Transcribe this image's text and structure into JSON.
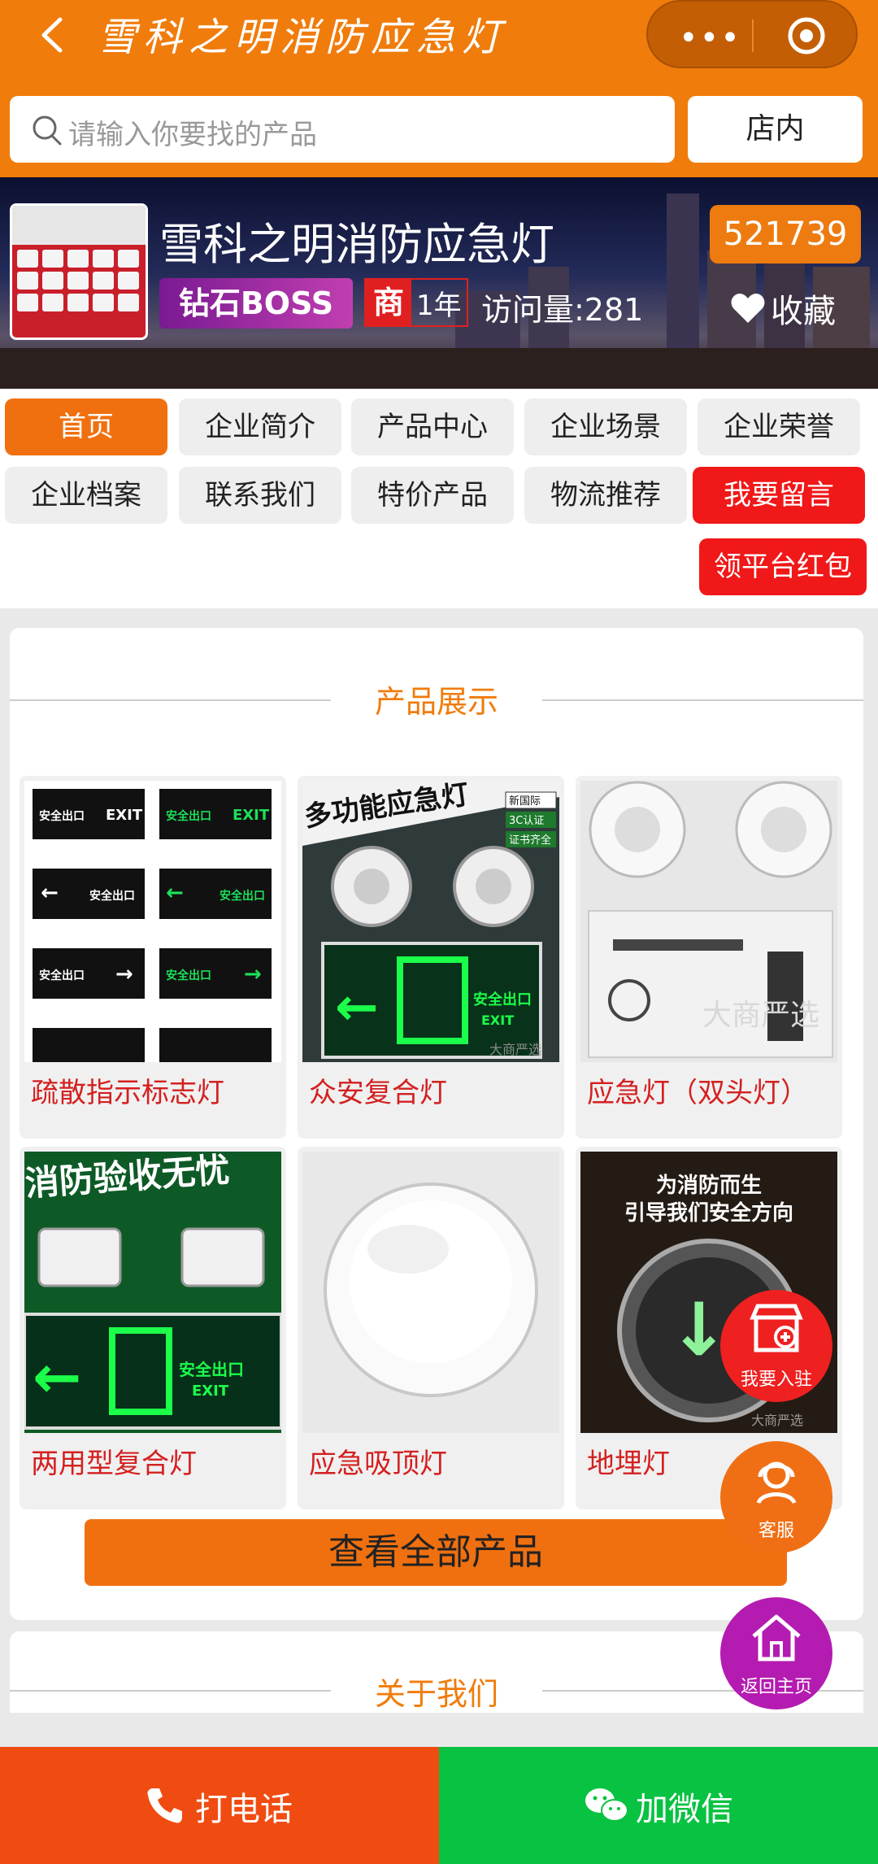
{
  "header": {
    "title": "雪科之明消防应急灯",
    "search_placeholder": "请输入你要找的产品",
    "store_search_label": "店内"
  },
  "shop": {
    "name": "雪科之明消防应急灯",
    "id_badge": "521739",
    "level_badge": "钻石BOSS",
    "merchant_mark": "商",
    "years": "1年",
    "visits": "访问量:281",
    "favorite_label": "收藏"
  },
  "nav": {
    "items": [
      "首页",
      "企业简介",
      "产品中心",
      "企业场景",
      "企业荣誉",
      "企业档案",
      "联系我们",
      "特价产品",
      "物流推荐",
      "我要留言"
    ],
    "red_packet": "领平台红包"
  },
  "products": {
    "section_title": "产品展示",
    "items": [
      {
        "name": "疏散指示标志灯"
      },
      {
        "name": "众安复合灯"
      },
      {
        "name": "应急灯（双头灯）"
      },
      {
        "name": "两用型复合灯"
      },
      {
        "name": "应急吸顶灯"
      },
      {
        "name": "地埋灯"
      }
    ],
    "image_texts": {
      "p2_headline": "多功能应急灯",
      "p2_tag1": "新国际",
      "p2_tag2": "3C认证",
      "p2_tag3": "证书齐全",
      "p4_headline": "消防验收无忧",
      "p6_line1": "为消防而生",
      "p6_line2": "引导我们安全方向",
      "exit_cn": "安全出口",
      "exit_en": "EXIT",
      "watermark": "大商严选"
    },
    "view_all": "查看全部产品"
  },
  "about": {
    "section_title": "关于我们"
  },
  "floating": {
    "join": "我要入驻",
    "service": "客服",
    "home": "返回主页"
  },
  "bottom": {
    "call": "打电话",
    "wechat": "加微信"
  },
  "colors": {
    "brand_orange": "#f07c0c",
    "accent_red": "#f01818",
    "wechat_green": "#08c241",
    "call_orange": "#f04c12"
  }
}
